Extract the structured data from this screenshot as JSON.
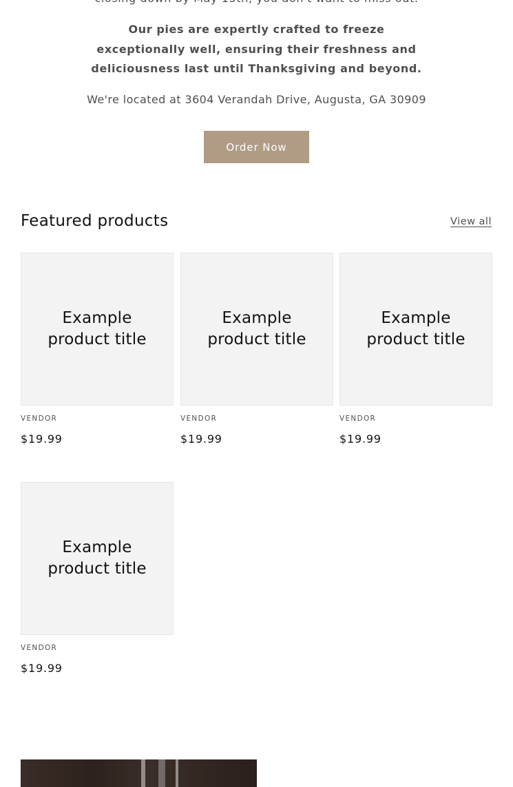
{
  "intro": {
    "cut_line": "closing down by May 15th, you don't want to miss out.",
    "bold_text": "Our pies are expertly crafted to freeze exceptionally well, ensuring their freshness and deliciousness last until Thanksgiving and beyond.",
    "address": "We're located at 3604 Verandah Drive, Augusta, GA 30909",
    "order_button_label": "Order Now"
  },
  "featured": {
    "title": "Featured products",
    "view_all_label": "View all",
    "products": [
      {
        "title": "Example product title",
        "vendor": "VENDOR",
        "price": "$19.99"
      },
      {
        "title": "Example product title",
        "vendor": "VENDOR",
        "price": "$19.99"
      },
      {
        "title": "Example product title",
        "vendor": "VENDOR",
        "price": "$19.99"
      },
      {
        "title": "Example product title",
        "vendor": "VENDOR",
        "price": "$19.99"
      }
    ]
  },
  "colors": {
    "button_bg": "#b09b85",
    "card_bg": "#f3f3f3",
    "text": "#121212"
  }
}
